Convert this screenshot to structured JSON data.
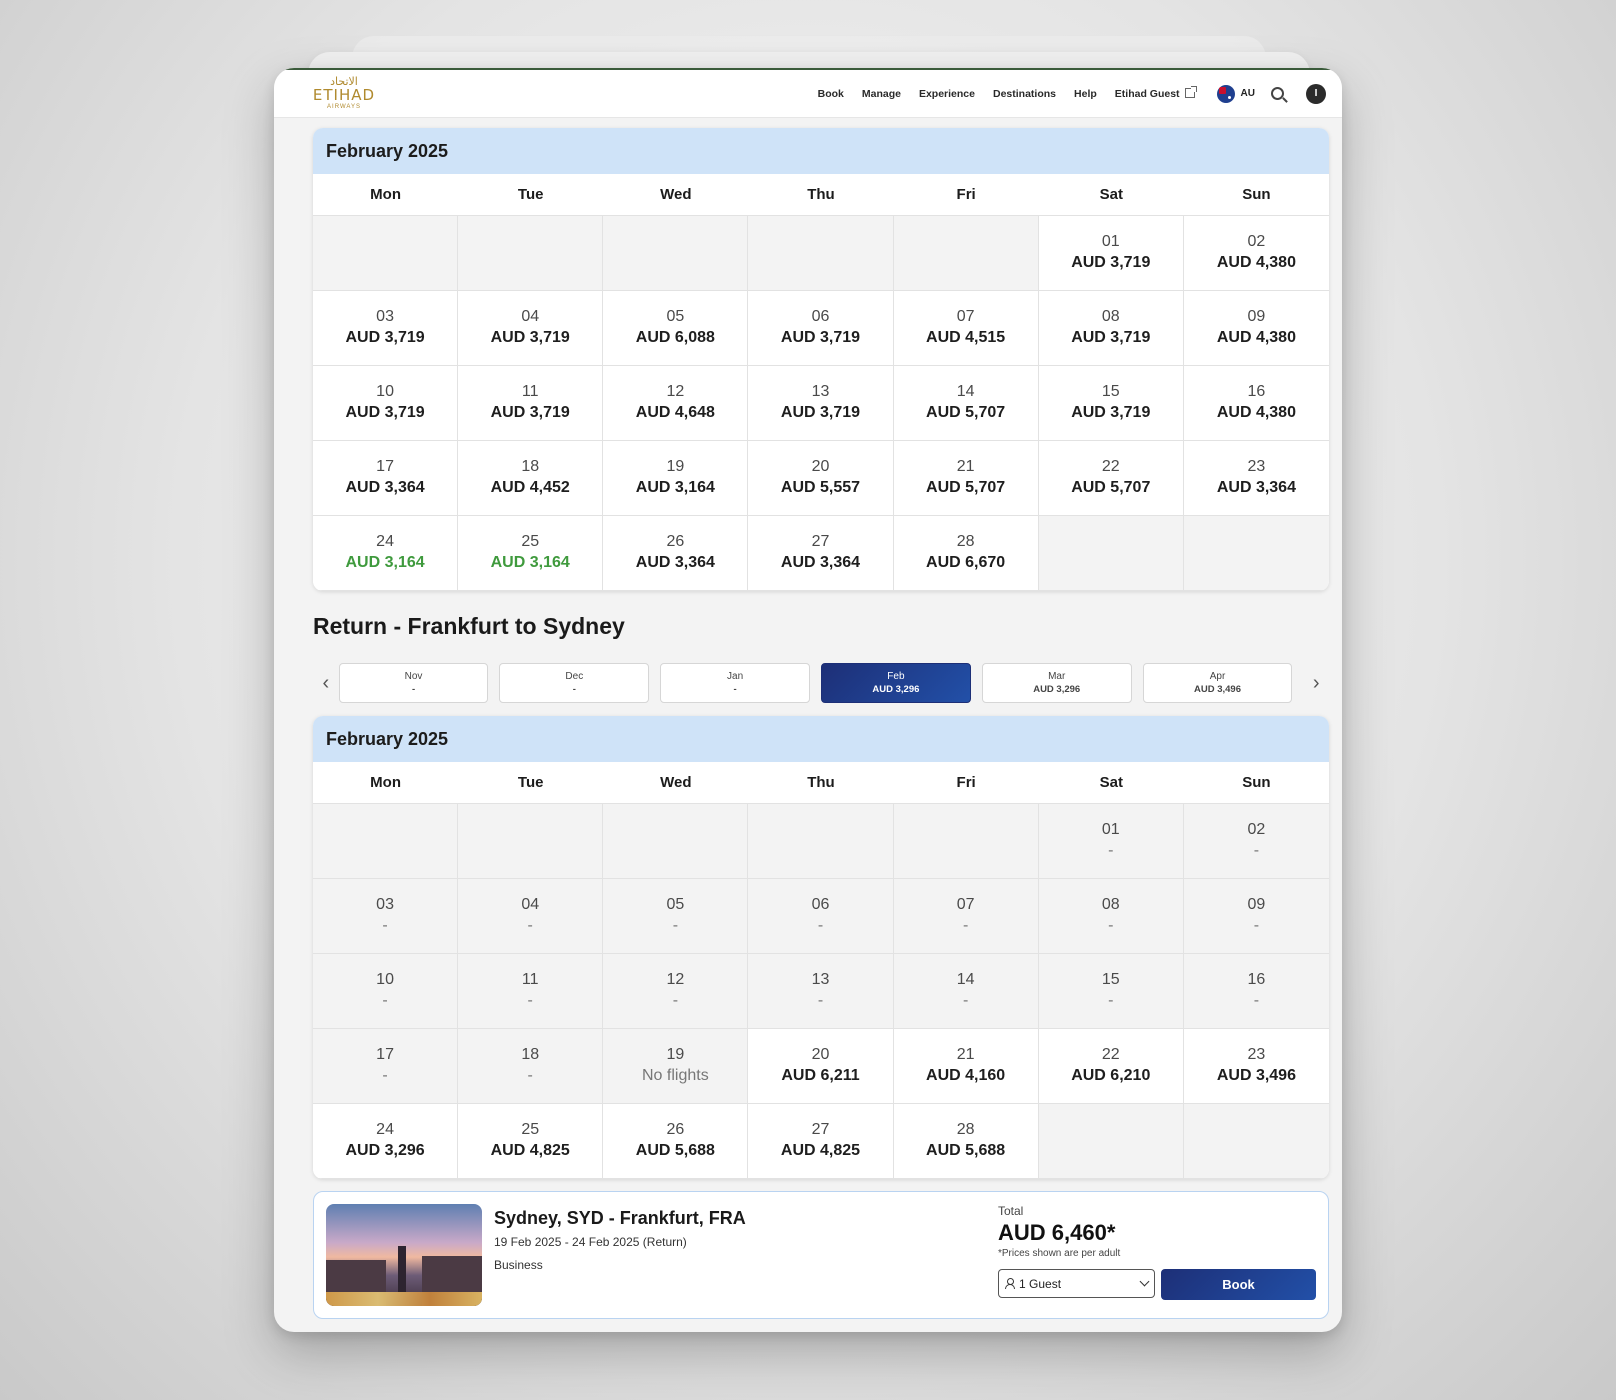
{
  "header": {
    "logo": {
      "arabic": "الاتحاد",
      "main": "ETIHAD",
      "sub": "AIRWAYS"
    },
    "nav": [
      "Book",
      "Manage",
      "Experience",
      "Destinations",
      "Help",
      "Etihad Guest"
    ],
    "locale": "AU",
    "user_initial": "I"
  },
  "outbound": {
    "month_title": "February 2025",
    "weekdays": [
      "Mon",
      "Tue",
      "Wed",
      "Thu",
      "Fri",
      "Sat",
      "Sun"
    ],
    "cells": [
      {
        "day": "",
        "price": "",
        "state": "empty"
      },
      {
        "day": "",
        "price": "",
        "state": "empty"
      },
      {
        "day": "",
        "price": "",
        "state": "empty"
      },
      {
        "day": "",
        "price": "",
        "state": "empty"
      },
      {
        "day": "",
        "price": "",
        "state": "empty"
      },
      {
        "day": "01",
        "price": "AUD 3,719",
        "state": "normal"
      },
      {
        "day": "02",
        "price": "AUD 4,380",
        "state": "normal"
      },
      {
        "day": "03",
        "price": "AUD 3,719",
        "state": "normal"
      },
      {
        "day": "04",
        "price": "AUD 3,719",
        "state": "normal"
      },
      {
        "day": "05",
        "price": "AUD 6,088",
        "state": "normal"
      },
      {
        "day": "06",
        "price": "AUD 3,719",
        "state": "normal"
      },
      {
        "day": "07",
        "price": "AUD 4,515",
        "state": "normal"
      },
      {
        "day": "08",
        "price": "AUD 3,719",
        "state": "normal"
      },
      {
        "day": "09",
        "price": "AUD 4,380",
        "state": "normal"
      },
      {
        "day": "10",
        "price": "AUD 3,719",
        "state": "normal"
      },
      {
        "day": "11",
        "price": "AUD 3,719",
        "state": "normal"
      },
      {
        "day": "12",
        "price": "AUD 4,648",
        "state": "normal"
      },
      {
        "day": "13",
        "price": "AUD 3,719",
        "state": "normal"
      },
      {
        "day": "14",
        "price": "AUD 5,707",
        "state": "normal"
      },
      {
        "day": "15",
        "price": "AUD 3,719",
        "state": "normal"
      },
      {
        "day": "16",
        "price": "AUD 4,380",
        "state": "normal"
      },
      {
        "day": "17",
        "price": "AUD 3,364",
        "state": "normal"
      },
      {
        "day": "18",
        "price": "AUD 4,452",
        "state": "normal"
      },
      {
        "day": "19",
        "price": "AUD 3,164",
        "state": "selected",
        "arrow": "→"
      },
      {
        "day": "20",
        "price": "AUD 5,557",
        "state": "normal"
      },
      {
        "day": "21",
        "price": "AUD 5,707",
        "state": "normal"
      },
      {
        "day": "22",
        "price": "AUD 5,707",
        "state": "normal"
      },
      {
        "day": "23",
        "price": "AUD 3,364",
        "state": "normal"
      },
      {
        "day": "24",
        "price": "AUD 3,164",
        "state": "cheap"
      },
      {
        "day": "25",
        "price": "AUD 3,164",
        "state": "cheap"
      },
      {
        "day": "26",
        "price": "AUD 3,364",
        "state": "normal"
      },
      {
        "day": "27",
        "price": "AUD 3,364",
        "state": "normal"
      },
      {
        "day": "28",
        "price": "AUD 6,670",
        "state": "normal"
      },
      {
        "day": "",
        "price": "",
        "state": "empty"
      },
      {
        "day": "",
        "price": "",
        "state": "empty"
      }
    ]
  },
  "return": {
    "title": "Return - Frankfurt to Sydney",
    "months": [
      {
        "name": "Nov",
        "price": "-",
        "active": false
      },
      {
        "name": "Dec",
        "price": "-",
        "active": false
      },
      {
        "name": "Jan",
        "price": "-",
        "active": false
      },
      {
        "name": "Feb",
        "price": "AUD 3,296",
        "active": true
      },
      {
        "name": "Mar",
        "price": "AUD 3,296",
        "active": false
      },
      {
        "name": "Apr",
        "price": "AUD 3,496",
        "active": false
      }
    ],
    "month_title": "February 2025",
    "weekdays": [
      "Mon",
      "Tue",
      "Wed",
      "Thu",
      "Fri",
      "Sat",
      "Sun"
    ],
    "cells": [
      {
        "day": "",
        "price": "",
        "state": "empty"
      },
      {
        "day": "",
        "price": "",
        "state": "empty"
      },
      {
        "day": "",
        "price": "",
        "state": "empty"
      },
      {
        "day": "",
        "price": "",
        "state": "empty"
      },
      {
        "day": "",
        "price": "",
        "state": "empty"
      },
      {
        "day": "01",
        "price": "-",
        "state": "nodata"
      },
      {
        "day": "02",
        "price": "-",
        "state": "nodata"
      },
      {
        "day": "03",
        "price": "-",
        "state": "nodata"
      },
      {
        "day": "04",
        "price": "-",
        "state": "nodata"
      },
      {
        "day": "05",
        "price": "-",
        "state": "nodata"
      },
      {
        "day": "06",
        "price": "-",
        "state": "nodata"
      },
      {
        "day": "07",
        "price": "-",
        "state": "nodata"
      },
      {
        "day": "08",
        "price": "-",
        "state": "nodata"
      },
      {
        "day": "09",
        "price": "-",
        "state": "nodata"
      },
      {
        "day": "10",
        "price": "-",
        "state": "nodata"
      },
      {
        "day": "11",
        "price": "-",
        "state": "nodata"
      },
      {
        "day": "12",
        "price": "-",
        "state": "nodata"
      },
      {
        "day": "13",
        "price": "-",
        "state": "nodata"
      },
      {
        "day": "14",
        "price": "-",
        "state": "nodata"
      },
      {
        "day": "15",
        "price": "-",
        "state": "nodata"
      },
      {
        "day": "16",
        "price": "-",
        "state": "nodata"
      },
      {
        "day": "17",
        "price": "-",
        "state": "nodata"
      },
      {
        "day": "18",
        "price": "-",
        "state": "nodata"
      },
      {
        "day": "19",
        "price": "No flights",
        "state": "nodata"
      },
      {
        "day": "20",
        "price": "AUD 6,211",
        "state": "normal"
      },
      {
        "day": "21",
        "price": "AUD 4,160",
        "state": "normal"
      },
      {
        "day": "22",
        "price": "AUD 6,210",
        "state": "normal"
      },
      {
        "day": "23",
        "price": "AUD 3,496",
        "state": "normal"
      },
      {
        "day": "24",
        "price": "AUD 3,296",
        "state": "selected",
        "arrow": "←"
      },
      {
        "day": "25",
        "price": "AUD 4,825",
        "state": "normal"
      },
      {
        "day": "26",
        "price": "AUD 5,688",
        "state": "normal"
      },
      {
        "day": "27",
        "price": "AUD 4,825",
        "state": "normal"
      },
      {
        "day": "28",
        "price": "AUD 5,688",
        "state": "normal"
      },
      {
        "day": "",
        "price": "",
        "state": "empty"
      },
      {
        "day": "",
        "price": "",
        "state": "empty"
      }
    ]
  },
  "summary": {
    "route": "Sydney, SYD - Frankfurt, FRA",
    "dates": "19 Feb 2025 - 24 Feb 2025 (Return)",
    "cabin": "Business",
    "total_label": "Total",
    "total": "AUD 6,460*",
    "note": "*Prices shown are per adult",
    "guests": "1 Guest",
    "book_label": "Book"
  },
  "colors": {
    "accent": "#1d2f77",
    "header_band": "#cfe3f8",
    "cheap": "#3f9a3d",
    "brand_gold": "#b08a2e"
  }
}
